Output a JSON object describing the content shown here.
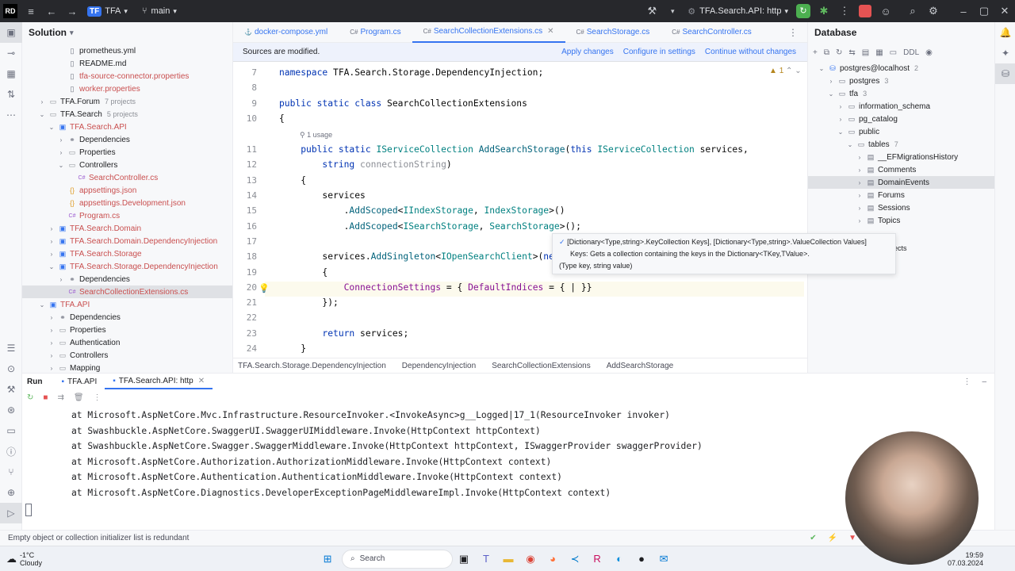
{
  "titlebar": {
    "project_badge": "TF",
    "project_name": "TFA",
    "branch": "main",
    "run_config": "TFA.Search.API: http"
  },
  "solution": {
    "title": "Solution",
    "items": [
      {
        "label": "prometheus.yml",
        "indent": 4,
        "icon": "file-icon",
        "color": "#1e1f22"
      },
      {
        "label": "README.md",
        "indent": 4,
        "icon": "file-icon",
        "color": "#1e1f22"
      },
      {
        "label": "tfa-source-connector.properties",
        "indent": 4,
        "icon": "file-icon",
        "color": "#c94f4f"
      },
      {
        "label": "worker.properties",
        "indent": 4,
        "icon": "file-icon",
        "color": "#c94f4f"
      },
      {
        "label": "TFA.Forum",
        "muted": "7 projects",
        "indent": 2,
        "arrow": ">",
        "icon": "folder-icon",
        "color": "#1e1f22"
      },
      {
        "label": "TFA.Search",
        "muted": "5 projects",
        "indent": 2,
        "arrow": "v",
        "icon": "folder-icon",
        "color": "#1e1f22"
      },
      {
        "label": "TFA.Search.API",
        "indent": 3,
        "arrow": "v",
        "icon": "project-icon",
        "color": "#c94f4f"
      },
      {
        "label": "Dependencies",
        "indent": 4,
        "arrow": ">",
        "icon": "deps-icon",
        "color": "#1e1f22"
      },
      {
        "label": "Properties",
        "indent": 4,
        "arrow": ">",
        "icon": "folder-icon",
        "color": "#1e1f22"
      },
      {
        "label": "Controllers",
        "indent": 4,
        "arrow": "v",
        "icon": "folder-icon",
        "color": "#1e1f22"
      },
      {
        "label": "SearchController.cs",
        "indent": 5,
        "icon": "cs-icon",
        "color": "#c94f4f"
      },
      {
        "label": "appsettings.json",
        "indent": 4,
        "icon": "json-icon",
        "color": "#c94f4f"
      },
      {
        "label": "appsettings.Development.json",
        "indent": 4,
        "icon": "json-icon",
        "color": "#c94f4f"
      },
      {
        "label": "Program.cs",
        "indent": 4,
        "icon": "cs-icon",
        "color": "#c94f4f"
      },
      {
        "label": "TFA.Search.Domain",
        "indent": 3,
        "arrow": ">",
        "icon": "project-icon",
        "color": "#c94f4f"
      },
      {
        "label": "TFA.Search.Domain.DependencyInjection",
        "indent": 3,
        "arrow": ">",
        "icon": "project-icon",
        "color": "#c94f4f"
      },
      {
        "label": "TFA.Search.Storage",
        "indent": 3,
        "arrow": ">",
        "icon": "project-icon",
        "color": "#c94f4f"
      },
      {
        "label": "TFA.Search.Storage.DependencyInjection",
        "indent": 3,
        "arrow": "v",
        "icon": "project-icon",
        "color": "#c94f4f"
      },
      {
        "label": "Dependencies",
        "indent": 4,
        "arrow": ">",
        "icon": "deps-icon",
        "color": "#1e1f22"
      },
      {
        "label": "SearchCollectionExtensions.cs",
        "indent": 4,
        "icon": "cs-icon",
        "color": "#c94f4f",
        "selected": true
      },
      {
        "label": "TFA.API",
        "indent": 2,
        "arrow": "v",
        "icon": "project-icon",
        "color": "#c94f4f"
      },
      {
        "label": "Dependencies",
        "indent": 3,
        "arrow": ">",
        "icon": "deps-icon",
        "color": "#1e1f22"
      },
      {
        "label": "Properties",
        "indent": 3,
        "arrow": ">",
        "icon": "folder-icon",
        "color": "#1e1f22"
      },
      {
        "label": "Authentication",
        "indent": 3,
        "arrow": ">",
        "icon": "folder-icon",
        "color": "#1e1f22"
      },
      {
        "label": "Controllers",
        "indent": 3,
        "arrow": ">",
        "icon": "folder-icon",
        "color": "#1e1f22"
      },
      {
        "label": "Mapping",
        "indent": 3,
        "arrow": ">",
        "icon": "folder-icon",
        "color": "#1e1f22"
      }
    ]
  },
  "editor": {
    "tabs": [
      {
        "label": "docker-compose.yml",
        "active": false
      },
      {
        "label": "Program.cs",
        "active": false
      },
      {
        "label": "SearchCollectionExtensions.cs",
        "active": true
      },
      {
        "label": "SearchStorage.cs",
        "active": false
      },
      {
        "label": "SearchController.cs",
        "active": false
      }
    ],
    "notice": {
      "text": "Sources are modified.",
      "apply": "Apply changes",
      "configure": "Configure in settings",
      "continue": "Continue without changes"
    },
    "warning_count": "1",
    "usage_hint": "1 usage",
    "line_numbers": [
      "7",
      "8",
      "9",
      "10",
      "11",
      "12",
      "13",
      "14",
      "15",
      "16",
      "17",
      "18",
      "19",
      "20",
      "21",
      "22",
      "23",
      "24"
    ],
    "hint": {
      "line1": "[Dictionary<Type,string>.KeyCollection Keys], [Dictionary<Type,string>.ValueCollection Values]",
      "line2": "Keys: Gets a collection containing the keys in the Dictionary<TKey,TValue>.",
      "line3": "(Type key, string value)"
    },
    "breadcrumb": [
      "TFA.Search.Storage.DependencyInjection",
      "DependencyInjection",
      "SearchCollectionExtensions",
      "AddSearchStorage"
    ]
  },
  "database": {
    "title": "Database",
    "items": [
      {
        "label": "postgres@localhost",
        "muted": "2",
        "indent": 1,
        "arrow": "v"
      },
      {
        "label": "postgres",
        "muted": "3",
        "indent": 2,
        "arrow": ">"
      },
      {
        "label": "tfa",
        "muted": "3",
        "indent": 2,
        "arrow": "v"
      },
      {
        "label": "information_schema",
        "indent": 3,
        "arrow": ">"
      },
      {
        "label": "pg_catalog",
        "indent": 3,
        "arrow": ">"
      },
      {
        "label": "public",
        "indent": 3,
        "arrow": "v"
      },
      {
        "label": "tables",
        "muted": "7",
        "indent": 4,
        "arrow": "v"
      },
      {
        "label": "__EFMigrationsHistory",
        "indent": 5,
        "arrow": ">"
      },
      {
        "label": "Comments",
        "indent": 5,
        "arrow": ">"
      },
      {
        "label": "DomainEvents",
        "indent": 5,
        "arrow": ">",
        "selected": true
      },
      {
        "label": "Forums",
        "indent": 5,
        "arrow": ">"
      },
      {
        "label": "Sessions",
        "indent": 5,
        "arrow": ">"
      },
      {
        "label": "Topics",
        "indent": 5,
        "arrow": ">"
      }
    ],
    "clipped_text": "jects"
  },
  "run": {
    "title": "Run",
    "tabs": [
      "TFA.API",
      "TFA.Search.API: http"
    ],
    "lines": [
      "at Microsoft.AspNetCore.Mvc.Infrastructure.ResourceInvoker.<InvokeAsync>g__Logged|17_1(ResourceInvoker invoker)",
      "at Swashbuckle.AspNetCore.SwaggerUI.SwaggerUIMiddleware.Invoke(HttpContext httpContext)",
      "at Swashbuckle.AspNetCore.Swagger.SwaggerMiddleware.Invoke(HttpContext httpContext, ISwaggerProvider swaggerProvider)",
      "at Microsoft.AspNetCore.Authorization.AuthorizationMiddleware.Invoke(HttpContext context)",
      "at Microsoft.AspNetCore.Authentication.AuthenticationMiddleware.Invoke(HttpContext context)",
      "at Microsoft.AspNetCore.Diagnostics.DeveloperExceptionPageMiddlewareImpl.Invoke(HttpContext context)"
    ]
  },
  "statusbar": {
    "message": "Empty object or collection initializer list is redundant"
  },
  "taskbar": {
    "weather_temp": "-1°C",
    "weather_desc": "Cloudy",
    "search": "Search",
    "time": "19:59",
    "date": "07.03.2024"
  }
}
